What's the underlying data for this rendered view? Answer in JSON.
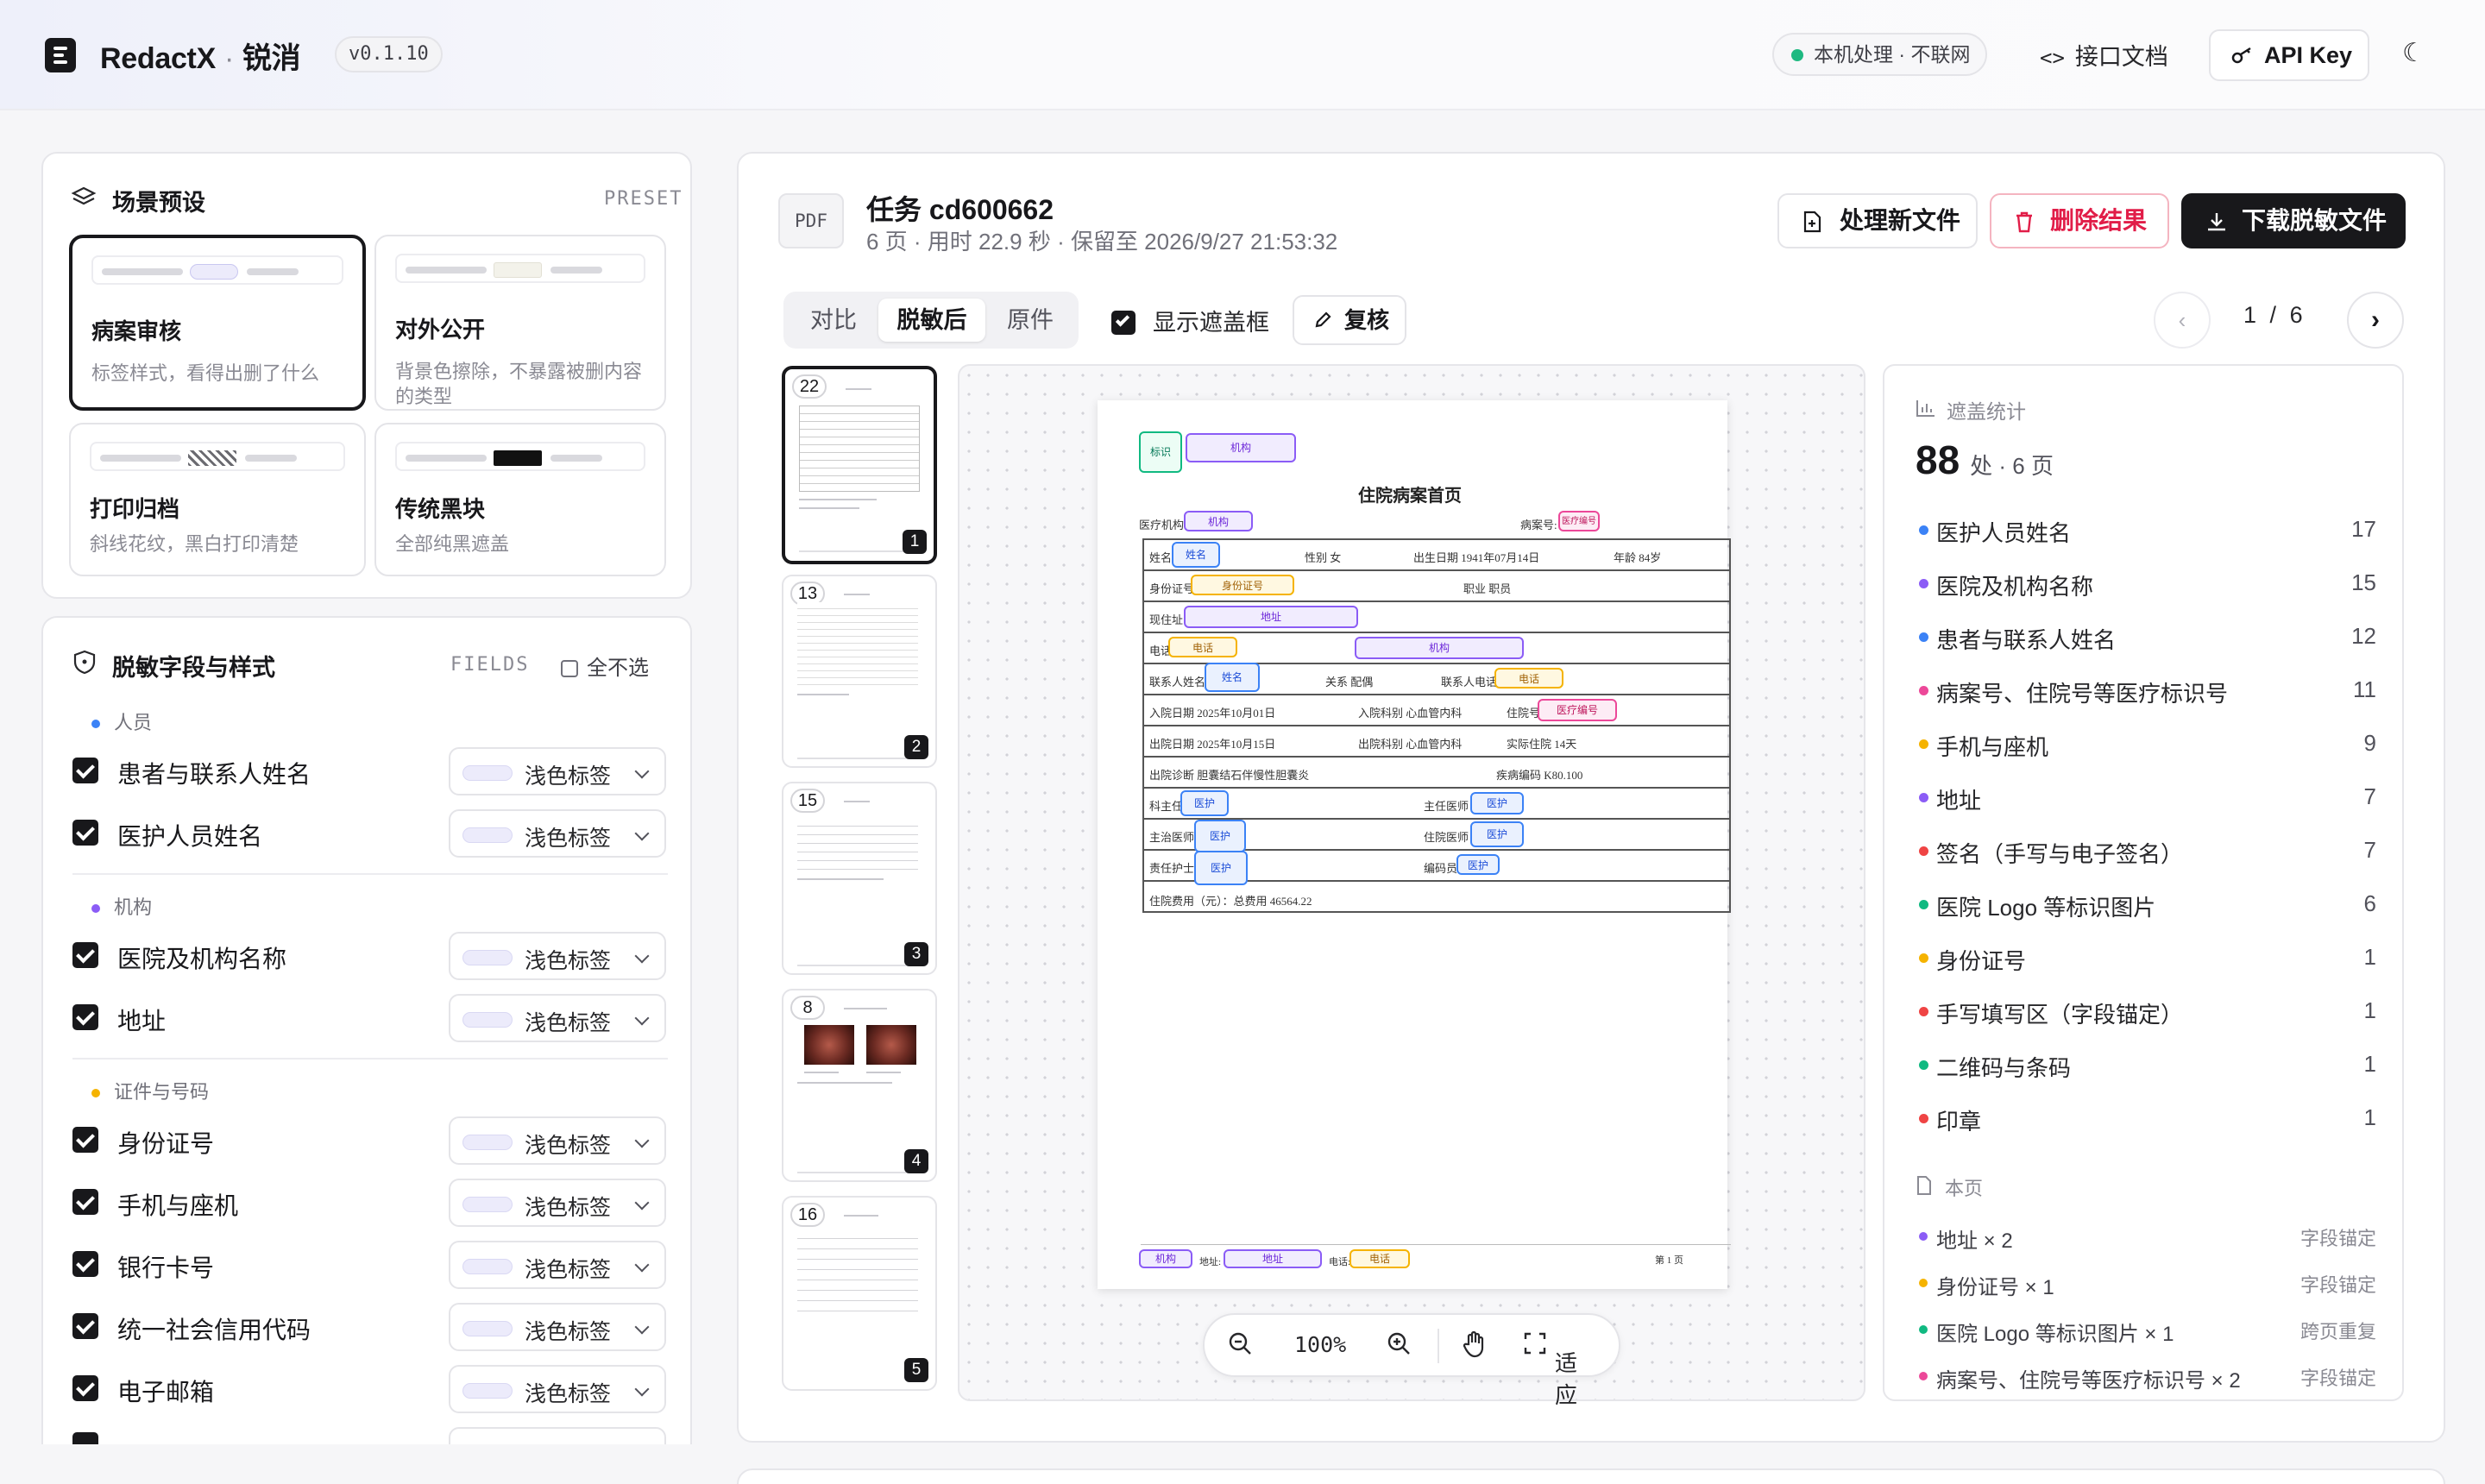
{
  "header": {
    "title": "RedactX",
    "sep": "·",
    "subtitle": "锐消",
    "version": "v0.1.10",
    "local_badge": "本机处理 · 不联网",
    "api_docs": "接口文档",
    "api_key": "API Key"
  },
  "presets": {
    "title": "场景预设",
    "tag": "PRESET",
    "items": [
      {
        "name": "病案审核",
        "desc": "标签样式，看得出删了什么"
      },
      {
        "name": "对外公开",
        "desc": "背景色擦除，不暴露被删内容的类型"
      },
      {
        "name": "打印归档",
        "desc": "斜线花纹，黑白打印清楚"
      },
      {
        "name": "传统黑块",
        "desc": "全部纯黑遮盖"
      }
    ]
  },
  "fields": {
    "title": "脱敏字段与样式",
    "tag": "FIELDS",
    "select_none": "全不选",
    "groups": [
      {
        "name": "人员",
        "color": "#3b82f6",
        "items": [
          {
            "label": "患者与联系人姓名",
            "style": "浅色标签"
          },
          {
            "label": "医护人员姓名",
            "style": "浅色标签"
          }
        ]
      },
      {
        "name": "机构",
        "color": "#8b5cf6",
        "items": [
          {
            "label": "医院及机构名称",
            "style": "浅色标签"
          },
          {
            "label": "地址",
            "style": "浅色标签"
          }
        ]
      },
      {
        "name": "证件与号码",
        "color": "#f5b300",
        "items": [
          {
            "label": "身份证号",
            "style": "浅色标签"
          },
          {
            "label": "手机与座机",
            "style": "浅色标签"
          },
          {
            "label": "银行卡号",
            "style": "浅色标签"
          },
          {
            "label": "统一社会信用代码",
            "style": "浅色标签"
          },
          {
            "label": "电子邮箱",
            "style": "浅色标签"
          }
        ]
      }
    ]
  },
  "task": {
    "badge": "PDF",
    "title": "任务 cd600662",
    "meta": "6 页 · 用时 22.9 秒 · 保留至 2026/9/27 21:53:32",
    "btn_new": "处理新文件",
    "btn_delete": "删除结果",
    "btn_download": "下载脱敏文件",
    "tabs": [
      "对比",
      "脱敏后",
      "原件"
    ],
    "show_mask": "显示遮盖框",
    "review": "复核",
    "page_current": "1",
    "page_sep": "/",
    "page_total": "6"
  },
  "thumbs": [
    {
      "count": "22",
      "page": "1"
    },
    {
      "count": "13",
      "page": "2"
    },
    {
      "count": "15",
      "page": "3"
    },
    {
      "count": "8",
      "page": "4"
    },
    {
      "count": "16",
      "page": "5"
    }
  ],
  "document": {
    "header_tags": {
      "logo": "标识",
      "org": "机构"
    },
    "title": "住院病案首页",
    "org_label": "医疗机构",
    "case_label": "病案号:",
    "rows": {
      "r1": {
        "name_label": "姓名",
        "gender": "性别  女",
        "birth": "出生日期  1941年07月14日",
        "age": "年龄  84岁"
      },
      "r2": {
        "id_label": "身份证号",
        "job": "职业  职员"
      },
      "r3": {
        "addr_label": "现住址"
      },
      "r4": {
        "phone_label": "电话"
      },
      "r5": {
        "contact_label": "联系人姓名",
        "relation": "关系  配偶",
        "contact_phone_label": "联系人电话"
      },
      "r6": {
        "admit": "入院日期  2025年10月01日",
        "admit_dept": "入院科别  心血管内科",
        "ward_label": "住院号"
      },
      "r7": {
        "discharge": "出院日期  2025年10月15日",
        "discharge_dept": "出院科别  心血管内科",
        "days": "实际住院  14天"
      },
      "r8": {
        "diag": "出院诊断  胆囊结石伴慢性胆囊炎",
        "code": "疾病编码  K80.100"
      },
      "r9": {
        "director": "科主任",
        "attending_chief": "主任医师"
      },
      "r10": {
        "attending": "主治医师",
        "resident": "住院医师"
      },
      "r11": {
        "nurse": "责任护士",
        "coder": "编码员"
      },
      "r12": {
        "cost": "住院费用（元）：总费用  46564.22"
      }
    },
    "footer": {
      "addr_label": "地址:",
      "phone_label": "电话:",
      "page": "第 1 页"
    },
    "labels": {
      "org": "机构",
      "name": "姓名",
      "id": "身份证号",
      "addr": "地址",
      "phone": "电话",
      "medno": "医疗编号",
      "staff": "医护"
    }
  },
  "zoom": {
    "level": "100%",
    "fit": "适应"
  },
  "stats": {
    "title": "遮盖统计",
    "total": "88",
    "unit": "处 · 6 页",
    "items": [
      {
        "label": "医护人员姓名",
        "count": "17",
        "color": "#3b82f6"
      },
      {
        "label": "医院及机构名称",
        "count": "15",
        "color": "#8b5cf6"
      },
      {
        "label": "患者与联系人姓名",
        "count": "12",
        "color": "#3b82f6"
      },
      {
        "label": "病案号、住院号等医疗标识号",
        "count": "11",
        "color": "#ec4899"
      },
      {
        "label": "手机与座机",
        "count": "9",
        "color": "#f5b300"
      },
      {
        "label": "地址",
        "count": "7",
        "color": "#8b5cf6"
      },
      {
        "label": "签名（手写与电子签名）",
        "count": "7",
        "color": "#ef4444"
      },
      {
        "label": "医院 Logo 等标识图片",
        "count": "6",
        "color": "#10b981"
      },
      {
        "label": "身份证号",
        "count": "1",
        "color": "#f5b300"
      },
      {
        "label": "手写填写区（字段锚定）",
        "count": "1",
        "color": "#ef4444"
      },
      {
        "label": "二维码与条码",
        "count": "1",
        "color": "#10b981"
      },
      {
        "label": "印章",
        "count": "1",
        "color": "#ef4444"
      }
    ],
    "page_title": "本页",
    "page_items": [
      {
        "label": "地址 × 2",
        "tag": "字段锚定",
        "color": "#8b5cf6"
      },
      {
        "label": "身份证号 × 1",
        "tag": "字段锚定",
        "color": "#f5b300"
      },
      {
        "label": "医院 Logo 等标识图片 × 1",
        "tag": "跨页重复",
        "color": "#10b981"
      },
      {
        "label": "病案号、住院号等医疗标识号 × 2",
        "tag": "字段锚定",
        "color": "#ec4899"
      }
    ]
  }
}
